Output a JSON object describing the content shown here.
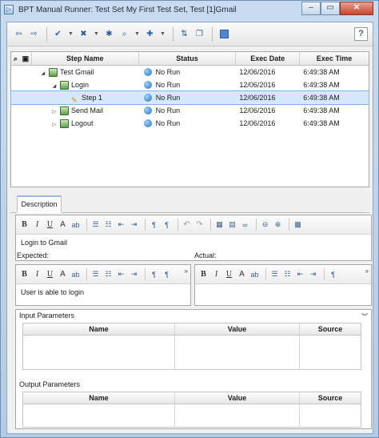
{
  "window": {
    "title": "BPT Manual Runner: Test Set My First Test Set, Test [1]Gmail",
    "minimize": "‒",
    "maximize": "▭",
    "close": "✕"
  },
  "toolbar": {
    "help": "?"
  },
  "grid": {
    "columns": [
      "Step Name",
      "Status",
      "Exec Date",
      "Exec Time"
    ],
    "rows": [
      {
        "name": "Test Gmail",
        "status": "No Run",
        "date": "12/06/2016",
        "time": "6:49:38 AM"
      },
      {
        "name": "Login",
        "status": "No Run",
        "date": "12/06/2016",
        "time": "6:49:38 AM"
      },
      {
        "name": "Step 1",
        "status": "No Run",
        "date": "12/06/2016",
        "time": "6:49:38 AM"
      },
      {
        "name": "Send Mail",
        "status": "No Run",
        "date": "12/06/2016",
        "time": "6:49:38 AM"
      },
      {
        "name": "Logout",
        "status": "No Run",
        "date": "12/06/2016",
        "time": "6:49:38 AM"
      }
    ]
  },
  "tabs": {
    "description": "Description"
  },
  "description": {
    "text": "Login to Gmail"
  },
  "expected": {
    "label": "Expected:",
    "text": "User is able to login"
  },
  "actual": {
    "label": "Actual:",
    "text": ""
  },
  "params": {
    "input_title": "Input Parameters",
    "output_title": "Output Parameters",
    "columns": [
      "Name",
      "Value",
      "Source"
    ]
  },
  "colors": {
    "selection": "#d6e8fb",
    "titlebar": "#c9dbef"
  }
}
